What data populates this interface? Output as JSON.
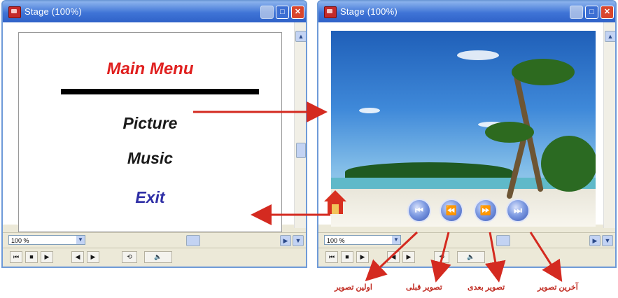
{
  "left_window": {
    "title": "Stage (100%)",
    "menu": {
      "title": "Main Menu",
      "items": [
        {
          "label": "Picture",
          "color": "#1a1a1a"
        },
        {
          "label": "Music",
          "color": "#1a1a1a"
        },
        {
          "label": "Exit",
          "color": "#2f2fa6"
        }
      ]
    },
    "zoom": "100 %"
  },
  "right_window": {
    "title": "Stage (100%)",
    "zoom": "100 %",
    "nav_buttons": [
      {
        "name": "first",
        "icon": "skip-back-icon"
      },
      {
        "name": "previous",
        "icon": "rewind-icon"
      },
      {
        "name": "next",
        "icon": "fast-forward-icon"
      },
      {
        "name": "last",
        "icon": "skip-forward-icon"
      }
    ]
  },
  "callouts": {
    "first": "اولین تصویر",
    "previous": "تصویر قبلی",
    "next": "تصویر بعدی",
    "last": "آخرین تصویر"
  },
  "colors": {
    "accent": "#e0201f",
    "titlebar": "#3f74d6",
    "arrow": "#d42a20"
  }
}
